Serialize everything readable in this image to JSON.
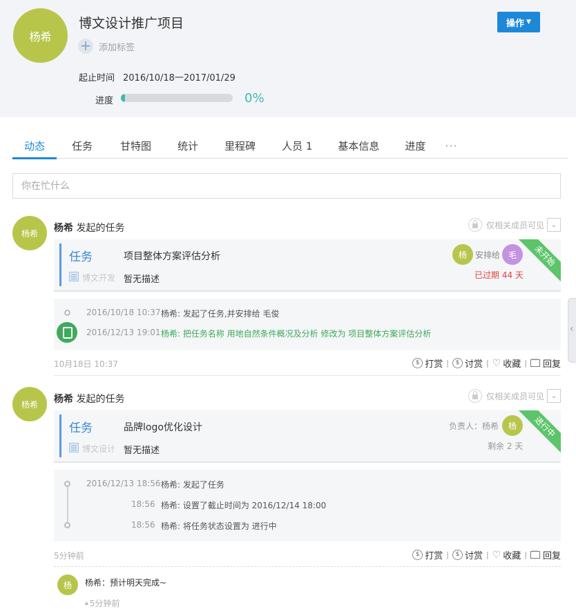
{
  "header": {
    "avatar_text": "杨希",
    "title": "博文设计推广项目",
    "add_tag_icon": "+",
    "add_tag_label": "添加标签",
    "ops_button": "操作",
    "period_label": "起止时间",
    "period_value": "2016/10/18一2017/01/29",
    "progress_label": "进度",
    "progress_value": "0%",
    "progress_fraction": 0
  },
  "tabs": [
    "动态",
    "任务",
    "甘特图",
    "统计",
    "里程碑",
    "人员 1",
    "基本信息",
    "进度",
    "···"
  ],
  "status_input": {
    "placeholder": "你在忙什么"
  },
  "feed": [
    {
      "avatar_text": "杨希",
      "author": "杨希",
      "action": "发起的任务",
      "visibility": "仅相关成员可见",
      "task": {
        "type": "任务",
        "title": "项目整体方案评估分析",
        "project": "博文开发",
        "description": "暂无描述",
        "assignee_avatar": "杨",
        "assign_text": "安排给",
        "target_avatar": "毛",
        "due_text": "已过期 44 天",
        "status": "未开始"
      },
      "logs": [
        {
          "time": "2016/10/18 10:37",
          "text": "杨希: 发起了任务,并安排给 毛俊"
        },
        {
          "time": "2016/12/13 19:01",
          "text": "杨希: 把任务名称 用地自然条件概况及分析 修改为 项目整体方案评估分析"
        }
      ],
      "timestamp": "10月18日 10:37",
      "actions": [
        "打赏",
        "讨赏",
        "收藏",
        "回复"
      ]
    },
    {
      "avatar_text": "杨希",
      "author": "杨希",
      "action": "发起的任务",
      "visibility": "仅相关成员可见",
      "task": {
        "type": "任务",
        "title": "品牌logo优化设计",
        "project": "博文设计",
        "description": "暂无描述",
        "owner_label": "负责人：杨希",
        "owner_avatar": "杨",
        "due_text": "剩余 2 天",
        "status": "进行中"
      },
      "logs": [
        {
          "time": "2016/12/13 18:56",
          "text": "杨希: 发起了任务"
        },
        {
          "time": "18:56",
          "text": "杨希: 设置了截止时间为 2016/12/14 18:00"
        },
        {
          "time": "18:56",
          "text": "杨希: 将任务状态设置为 进行中"
        }
      ],
      "timestamp": "5分钟前",
      "actions": [
        "打赏",
        "讨赏",
        "收藏",
        "回复"
      ],
      "comment": {
        "avatar": "杨",
        "text": "杨希：预计明天完成~",
        "time": "5分钟前"
      }
    }
  ],
  "colors": {
    "accent": "#1e88d8",
    "avatar": "#b7c64b",
    "progress": "#3fb8b1",
    "ribbon": "#5dc46a",
    "overdue": "#e0413b",
    "log_green": "#3eaa5a",
    "assignee2": "#c493e0"
  },
  "icons": {
    "coin": "coin-icon",
    "heart": "heart-icon",
    "reply": "reply-icon",
    "lock": "lock-icon",
    "dropdown": "chevron-down-icon"
  }
}
